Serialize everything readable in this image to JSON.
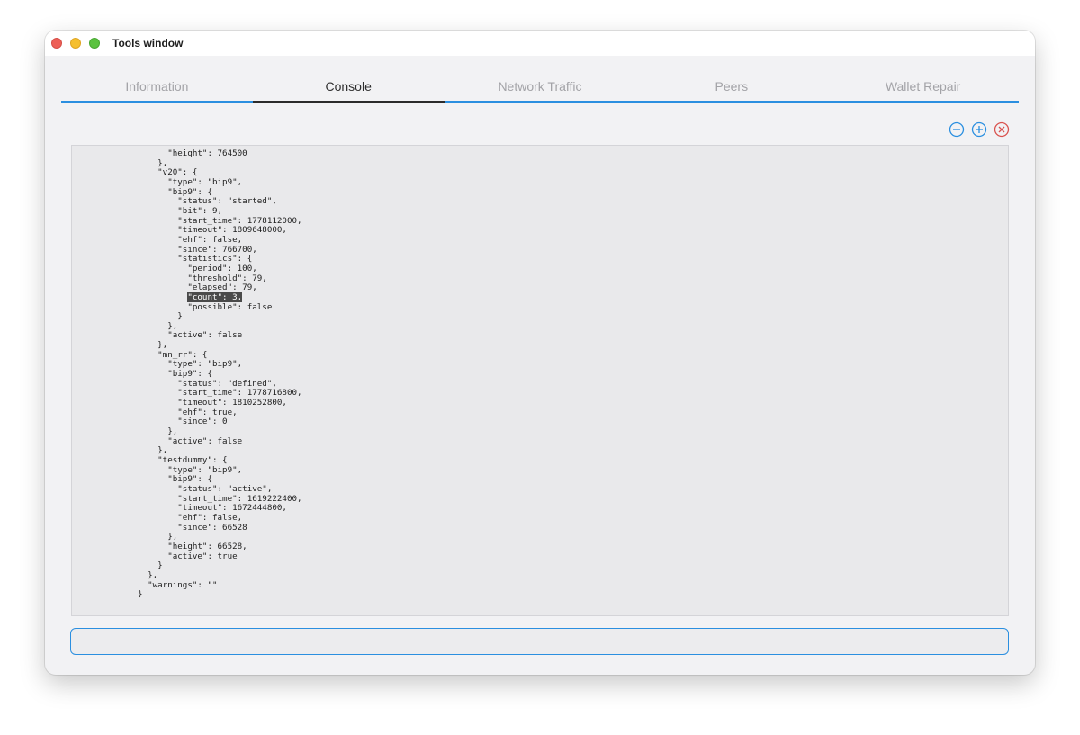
{
  "window": {
    "title": "Tools window"
  },
  "tabs": [
    {
      "label": "Information"
    },
    {
      "label": "Console"
    },
    {
      "label": "Network Traffic"
    },
    {
      "label": "Peers"
    },
    {
      "label": "Wallet Repair"
    }
  ],
  "toolbar": {
    "zoom_out_icon": "minus-circle",
    "zoom_in_icon": "plus-circle",
    "clear_icon": "x-circle",
    "accent_color": "#2b8fe0",
    "clear_color": "#d9534f"
  },
  "console": {
    "lines_before": [
      "      \"height\": 764500",
      "    },",
      "    \"v20\": {",
      "      \"type\": \"bip9\",",
      "      \"bip9\": {",
      "        \"status\": \"started\",",
      "        \"bit\": 9,",
      "        \"start_time\": 1778112000,",
      "        \"timeout\": 1809648000,",
      "        \"ehf\": false,",
      "        \"since\": 766700,",
      "        \"statistics\": {",
      "          \"period\": 100,",
      "          \"threshold\": 79,",
      "          \"elapsed\": 79,"
    ],
    "selected_text": "\"count\": 3,",
    "lines_after": [
      "          \"possible\": false",
      "        }",
      "      },",
      "      \"active\": false",
      "    },",
      "    \"mn_rr\": {",
      "      \"type\": \"bip9\",",
      "      \"bip9\": {",
      "        \"status\": \"defined\",",
      "        \"start_time\": 1778716800,",
      "        \"timeout\": 1810252800,",
      "        \"ehf\": true,",
      "        \"since\": 0",
      "      },",
      "      \"active\": false",
      "    },",
      "    \"testdummy\": {",
      "      \"type\": \"bip9\",",
      "      \"bip9\": {",
      "        \"status\": \"active\",",
      "        \"start_time\": 1619222400,",
      "        \"timeout\": 1672444800,",
      "        \"ehf\": false,",
      "        \"since\": 66528",
      "      },",
      "      \"height\": 66528,",
      "      \"active\": true",
      "    }",
      "  },",
      "  \"warnings\": \"\"",
      "}"
    ]
  },
  "input": {
    "value": "",
    "placeholder": ""
  }
}
